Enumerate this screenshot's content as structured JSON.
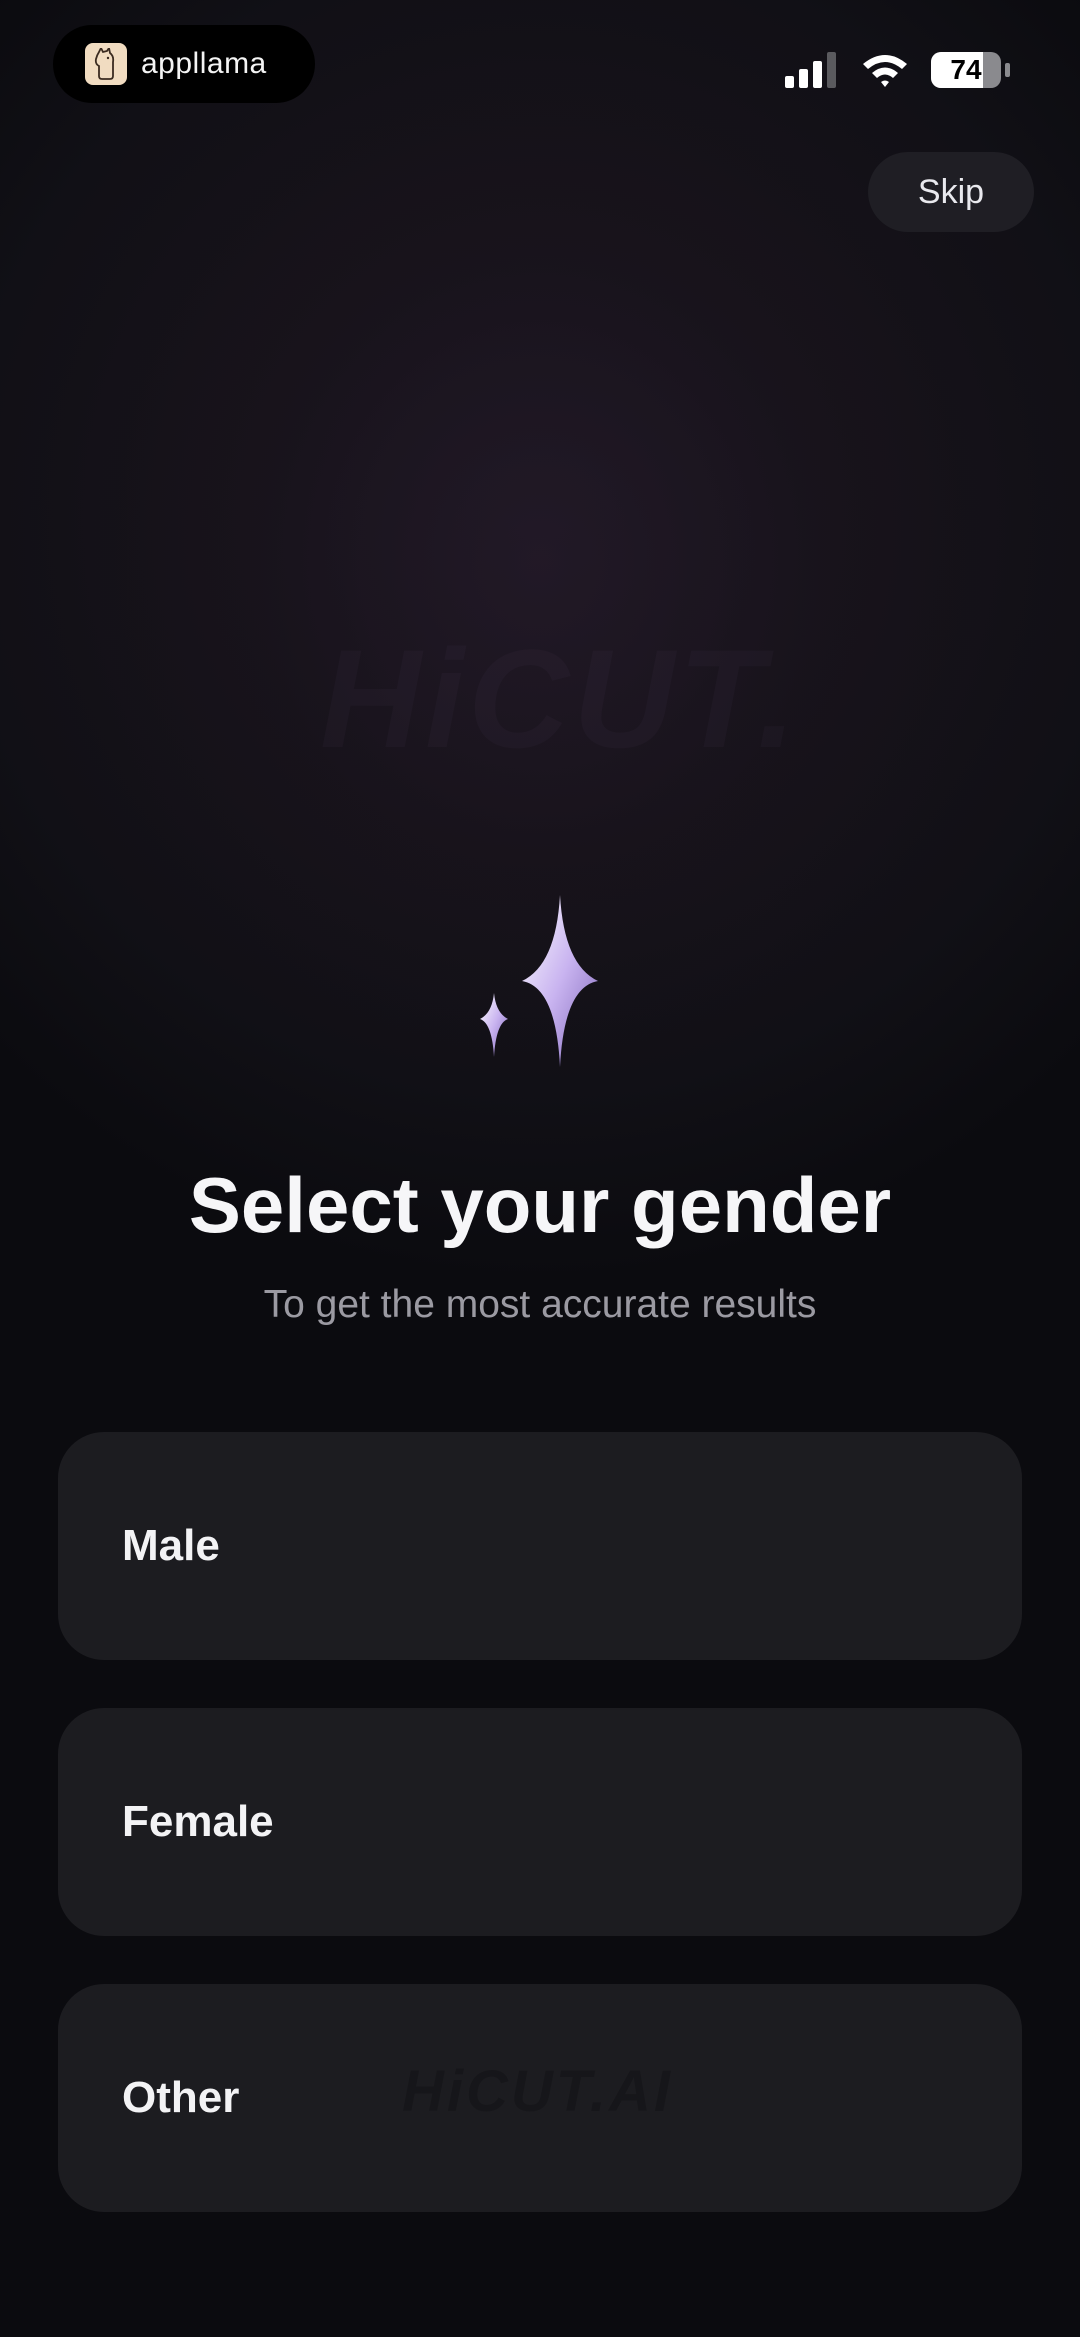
{
  "status_bar": {
    "app_pill_label": "appllama",
    "battery_level": "74",
    "battery_percent": 74
  },
  "header": {
    "skip_label": "Skip"
  },
  "watermark": {
    "large_text": "HiCUT.",
    "small_text": "HiCUT.AI"
  },
  "main": {
    "title": "Select your gender",
    "subtitle": "To get the most accurate results",
    "options": [
      {
        "label": "Male"
      },
      {
        "label": "Female"
      },
      {
        "label": "Other"
      }
    ]
  },
  "colors": {
    "background": "#0b0b0f",
    "card": "#1c1c20",
    "skip_button": "#1f1e24",
    "subtitle": "#9b9aa2",
    "sparkle": "#c9b4f0"
  },
  "icons": {
    "app_logo": "llama-logo-icon",
    "signal": "cellular-signal-icon",
    "wifi": "wifi-icon",
    "battery": "battery-icon",
    "sparkle": "sparkle-icon"
  }
}
